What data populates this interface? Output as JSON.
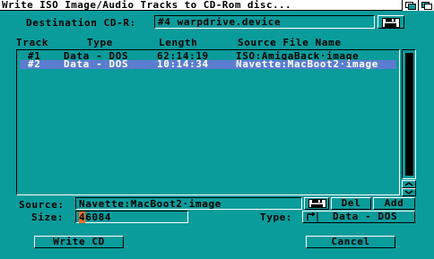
{
  "window": {
    "title": "Write ISO Image/Audio Tracks to CD-Rom disc..."
  },
  "destination": {
    "label": "Destination CD-R:",
    "value": "#4 warpdrive.device",
    "icon": "disk-icon"
  },
  "list": {
    "headers": {
      "track": "Track",
      "type": "Type",
      "length": "Length",
      "source": "Source File Name"
    },
    "rows": [
      {
        "track": "#1",
        "type": "Data - DOS",
        "length": "62:14:19",
        "source": "ISO:AmigaBack·image",
        "selected": false
      },
      {
        "track": "#2",
        "type": "Data - DOS",
        "length": "10:14:34",
        "source": "Navette:MacBoot2·image",
        "selected": true
      }
    ]
  },
  "source": {
    "label": "Source:",
    "value": "Navette:MacBoot2·image",
    "icon": "disk-icon",
    "del_label": "Del",
    "add_label": "Add"
  },
  "size": {
    "label": "Size:",
    "cursor_char": "4",
    "value_rest": "6084"
  },
  "type": {
    "label": "Type:",
    "value": "Data - DOS",
    "icon": "cycle-icon"
  },
  "actions": {
    "write_label": "Write CD",
    "cancel_label": "Cancel"
  },
  "colors": {
    "background": "#0a9b9b",
    "selection": "#5a7dcf",
    "cursor": "#f07020"
  }
}
